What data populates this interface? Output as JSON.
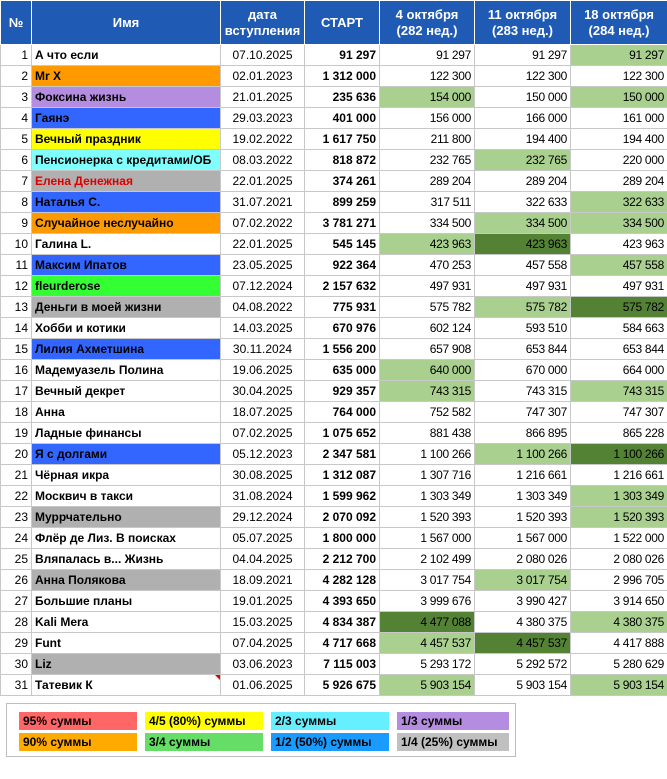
{
  "header": {
    "no": "№",
    "name": "Имя",
    "date": "дата вступления",
    "start": "СТАРТ",
    "w1": "4 октября (282 нед.)",
    "w2": "11 октября (283 нед.)",
    "w3": "18 октября (284 нед.)"
  },
  "colors": {
    "header_bg": "#1f5bb5",
    "green_light": "#a9d08e",
    "green_dark": "#548235",
    "orange": "#ff9900",
    "yellow": "#ffff00",
    "cyan": "#80ffff",
    "purple": "#b48ce0",
    "blue": "#3366ff",
    "lime": "#33ff33",
    "grey": "#b0b0b0",
    "red": "#ff6666"
  },
  "rows": [
    {
      "n": "1",
      "name": "А что если",
      "date": "07.10.2025",
      "start": "91 297",
      "w1": "91 297",
      "w2": "91 297",
      "w3": "91 297",
      "nameBg": "",
      "nameColor": "",
      "w1Bg": "",
      "w2Bg": "",
      "w3Bg": "light"
    },
    {
      "n": "2",
      "name": "Mr X",
      "date": "02.01.2023",
      "start": "1 312 000",
      "w1": "122 300",
      "w2": "122 300",
      "w3": "122 300",
      "nameBg": "orange",
      "nameColor": "",
      "w1Bg": "",
      "w2Bg": "",
      "w3Bg": ""
    },
    {
      "n": "3",
      "name": "Фоксина жизнь",
      "date": "21.01.2025",
      "start": "235 636",
      "w1": "154 000",
      "w2": "150 000",
      "w3": "150 000",
      "nameBg": "purple",
      "nameColor": "",
      "w1Bg": "light",
      "w2Bg": "",
      "w3Bg": "light"
    },
    {
      "n": "4",
      "name": "Гаянэ",
      "date": "29.03.2023",
      "start": "401 000",
      "w1": "156 000",
      "w2": "166 000",
      "w3": "161 000",
      "nameBg": "blue",
      "nameColor": "",
      "w1Bg": "",
      "w2Bg": "",
      "w3Bg": ""
    },
    {
      "n": "5",
      "name": "Вечный праздник",
      "date": "19.02.2022",
      "start": "1 617 750",
      "w1": "211 800",
      "w2": "194 400",
      "w3": "194 400",
      "nameBg": "yellow",
      "nameColor": "",
      "w1Bg": "",
      "w2Bg": "",
      "w3Bg": ""
    },
    {
      "n": "6",
      "name": "Пенсионерка с кредитами/ОБ",
      "date": "08.03.2022",
      "start": "818 872",
      "w1": "232 765",
      "w2": "232 765",
      "w3": "220 000",
      "nameBg": "cyan",
      "nameColor": "",
      "w1Bg": "",
      "w2Bg": "light",
      "w3Bg": ""
    },
    {
      "n": "7",
      "name": "Елена Денежная",
      "date": "22.01.2025",
      "start": "374 261",
      "w1": "289 204",
      "w2": "289 204",
      "w3": "289 204",
      "nameBg": "grey",
      "nameColor": "#e00000",
      "w1Bg": "",
      "w2Bg": "",
      "w3Bg": ""
    },
    {
      "n": "8",
      "name": "Наталья С.",
      "date": "31.07.2021",
      "start": "899 259",
      "w1": "317 511",
      "w2": "322 633",
      "w3": "322 633",
      "nameBg": "blue",
      "nameColor": "",
      "w1Bg": "",
      "w2Bg": "",
      "w3Bg": "light"
    },
    {
      "n": "9",
      "name": "Случайное неслучайно",
      "date": "07.02.2022",
      "start": "3 781 271",
      "w1": "334 500",
      "w2": "334 500",
      "w3": "334 500",
      "nameBg": "orange",
      "nameColor": "",
      "w1Bg": "",
      "w2Bg": "light",
      "w3Bg": "light"
    },
    {
      "n": "10",
      "name": "Галина L.",
      "date": "22.01.2025",
      "start": "545 145",
      "w1": "423 963",
      "w2": "423 963",
      "w3": "423 963",
      "nameBg": "",
      "nameColor": "",
      "w1Bg": "light",
      "w2Bg": "dark",
      "w3Bg": ""
    },
    {
      "n": "11",
      "name": "Максим Ипатов",
      "date": "23.05.2025",
      "start": "922 364",
      "w1": "470 253",
      "w2": "457 558",
      "w3": "457 558",
      "nameBg": "blue",
      "nameColor": "",
      "w1Bg": "",
      "w2Bg": "",
      "w3Bg": "light"
    },
    {
      "n": "12",
      "name": "fleurderose",
      "date": "07.12.2024",
      "start": "2 157 632",
      "w1": "497 931",
      "w2": "497 931",
      "w3": "497 931",
      "nameBg": "lime",
      "nameColor": "",
      "w1Bg": "",
      "w2Bg": "",
      "w3Bg": ""
    },
    {
      "n": "13",
      "name": "Деньги в моей жизни",
      "date": "04.08.2022",
      "start": "775 931",
      "w1": "575 782",
      "w2": "575 782",
      "w3": "575 782",
      "nameBg": "grey",
      "nameColor": "",
      "w1Bg": "",
      "w2Bg": "light",
      "w3Bg": "dark"
    },
    {
      "n": "14",
      "name": "Хобби и котики",
      "date": "14.03.2025",
      "start": "670 976",
      "w1": "602 124",
      "w2": "593 510",
      "w3": "584 663",
      "nameBg": "",
      "nameColor": "",
      "w1Bg": "",
      "w2Bg": "",
      "w3Bg": ""
    },
    {
      "n": "15",
      "name": "Лилия Ахметшина",
      "date": "30.11.2024",
      "start": "1 556 200",
      "w1": "657 908",
      "w2": "653 844",
      "w3": "653 844",
      "nameBg": "blue",
      "nameColor": "",
      "w1Bg": "",
      "w2Bg": "",
      "w3Bg": ""
    },
    {
      "n": "16",
      "name": "Мадемуазель Полина",
      "date": "19.06.2025",
      "start": "635 000",
      "w1": "640 000",
      "w2": "670 000",
      "w3": "664 000",
      "nameBg": "",
      "nameColor": "",
      "w1Bg": "light",
      "w2Bg": "",
      "w3Bg": ""
    },
    {
      "n": "17",
      "name": "Вечный декрет",
      "date": "30.04.2025",
      "start": "929 357",
      "w1": "743 315",
      "w2": "743 315",
      "w3": "743 315",
      "nameBg": "",
      "nameColor": "",
      "w1Bg": "light",
      "w2Bg": "",
      "w3Bg": "light"
    },
    {
      "n": "18",
      "name": "Анна",
      "date": "18.07.2025",
      "start": "764 000",
      "w1": "752 582",
      "w2": "747 307",
      "w3": "747 307",
      "nameBg": "",
      "nameColor": "",
      "w1Bg": "",
      "w2Bg": "",
      "w3Bg": ""
    },
    {
      "n": "19",
      "name": "Ладные финансы",
      "date": "07.02.2025",
      "start": "1 075 652",
      "w1": "881 438",
      "w2": "866 895",
      "w3": "865 228",
      "nameBg": "",
      "nameColor": "",
      "w1Bg": "",
      "w2Bg": "",
      "w3Bg": ""
    },
    {
      "n": "20",
      "name": "Я с долгами",
      "date": "05.12.2023",
      "start": "2 347 581",
      "w1": "1 100 266",
      "w2": "1 100 266",
      "w3": "1 100 266",
      "nameBg": "blue",
      "nameColor": "",
      "w1Bg": "",
      "w2Bg": "light",
      "w3Bg": "dark"
    },
    {
      "n": "21",
      "name": "Чёрная икра",
      "date": "30.08.2025",
      "start": "1 312 087",
      "w1": "1 307 716",
      "w2": "1 216 661",
      "w3": "1 216 661",
      "nameBg": "",
      "nameColor": "",
      "w1Bg": "",
      "w2Bg": "",
      "w3Bg": ""
    },
    {
      "n": "22",
      "name": "Москвич в такси",
      "date": "31.08.2024",
      "start": "1 599 962",
      "w1": "1 303 349",
      "w2": "1 303 349",
      "w3": "1 303 349",
      "nameBg": "",
      "nameColor": "",
      "w1Bg": "",
      "w2Bg": "",
      "w3Bg": "light"
    },
    {
      "n": "23",
      "name": "Муррчательно",
      "date": "29.12.2024",
      "start": "2 070 092",
      "w1": "1 520 393",
      "w2": "1 520 393",
      "w3": "1 520 393",
      "nameBg": "grey",
      "nameColor": "",
      "w1Bg": "",
      "w2Bg": "",
      "w3Bg": "light"
    },
    {
      "n": "24",
      "name": "Флёр де Лиз. В поисках",
      "date": "05.07.2025",
      "start": "1 800 000",
      "w1": "1 567 000",
      "w2": "1 567 000",
      "w3": "1 522 000",
      "nameBg": "",
      "nameColor": "",
      "w1Bg": "",
      "w2Bg": "",
      "w3Bg": ""
    },
    {
      "n": "25",
      "name": "Вляпалась в... Жизнь",
      "date": "04.04.2025",
      "start": "2 212 700",
      "w1": "2 102 499",
      "w2": "2 080 026",
      "w3": "2 080 026",
      "nameBg": "",
      "nameColor": "",
      "w1Bg": "",
      "w2Bg": "",
      "w3Bg": ""
    },
    {
      "n": "26",
      "name": "Анна Полякова",
      "date": "18.09.2021",
      "start": "4 282 128",
      "w1": "3 017 754",
      "w2": "3 017 754",
      "w3": "2 996 705",
      "nameBg": "grey",
      "nameColor": "",
      "w1Bg": "",
      "w2Bg": "light",
      "w3Bg": ""
    },
    {
      "n": "27",
      "name": "Большие планы",
      "date": "19.01.2025",
      "start": "4 393 650",
      "w1": "3 999 676",
      "w2": "3 990 427",
      "w3": "3 914 650",
      "nameBg": "",
      "nameColor": "",
      "w1Bg": "",
      "w2Bg": "",
      "w3Bg": ""
    },
    {
      "n": "28",
      "name": "Kali Mera",
      "date": "15.03.2025",
      "start": "4 834 387",
      "w1": "4 477 088",
      "w2": "4 380 375",
      "w3": "4 380 375",
      "nameBg": "",
      "nameColor": "",
      "w1Bg": "dark",
      "w2Bg": "",
      "w3Bg": "light"
    },
    {
      "n": "29",
      "name": "Funt",
      "date": "07.04.2025",
      "start": "4 717 668",
      "w1": "4 457 537",
      "w2": "4 457 537",
      "w3": "4 417 888",
      "nameBg": "",
      "nameColor": "",
      "w1Bg": "light",
      "w2Bg": "dark",
      "w3Bg": ""
    },
    {
      "n": "30",
      "name": "Liz",
      "date": "03.06.2023",
      "start": "7 115 003",
      "w1": "5 293 172",
      "w2": "5 292 572",
      "w3": "5 280 629",
      "nameBg": "grey",
      "nameColor": "",
      "w1Bg": "",
      "w2Bg": "",
      "w3Bg": ""
    },
    {
      "n": "31",
      "name": "Татевик К",
      "date": "01.06.2025",
      "start": "5 926 675",
      "w1": "5 903 154",
      "w2": "5 903 154",
      "w3": "5 903 154",
      "nameBg": "",
      "nameColor": "",
      "w1Bg": "light",
      "w2Bg": "",
      "w3Bg": "light"
    }
  ],
  "legend": [
    {
      "label": "95% суммы",
      "color": "#ff6666"
    },
    {
      "label": "4/5 (80%) суммы",
      "color": "#ffff00"
    },
    {
      "label": "2/3 суммы",
      "color": "#66f0ff"
    },
    {
      "label": "1/3 суммы",
      "color": "#b48ce0"
    },
    {
      "label": "90% суммы",
      "color": "#ffaa00"
    },
    {
      "label": "3/4 суммы",
      "color": "#66dd66"
    },
    {
      "label": "1/2 (50%) суммы",
      "color": "#1a9bff"
    },
    {
      "label": "1/4 (25%) суммы",
      "color": "#c0c0c0"
    }
  ]
}
